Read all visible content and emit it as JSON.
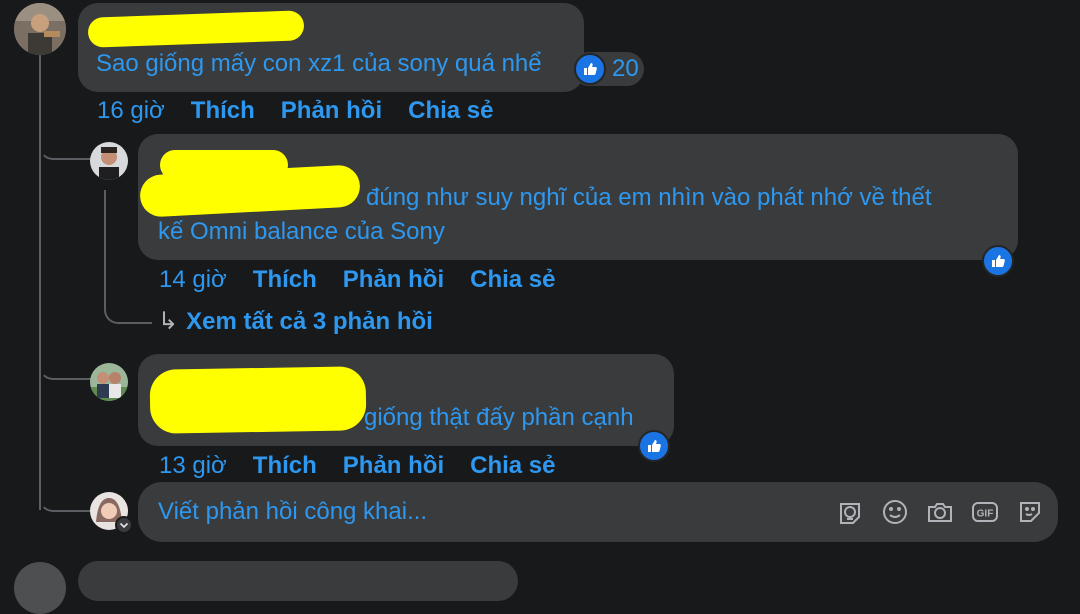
{
  "colors": {
    "background": "#18191a",
    "bubble": "#3a3b3c",
    "link": "#2e98f0",
    "like_blue": "#1b74e4",
    "redaction": "#ffff00"
  },
  "comment1": {
    "text": "Sao giống mấy con xz1 của sony quá nhể",
    "reaction_count": "20",
    "time": "16 giờ",
    "like": "Thích",
    "reply": "Phản hồi",
    "share": "Chia sẻ"
  },
  "reply1": {
    "text_line1": "đúng như suy nghĩ của em nhìn vào phát nhớ về thết",
    "text_line2": "kế Omni balance của Sony",
    "time": "14 giờ",
    "like": "Thích",
    "reply": "Phản hồi",
    "share": "Chia sẻ",
    "view_replies_arrow": "↳",
    "view_replies": "Xem tất cả 3 phản hồi"
  },
  "reply2": {
    "text": "giống thật đấy phần cạnh",
    "time": "13 giờ",
    "like": "Thích",
    "reply": "Phản hồi",
    "share": "Chia sẻ"
  },
  "composer": {
    "placeholder": "Viết phản hồi công khai...",
    "icons": [
      "avatar-sticker-icon",
      "emoji-icon",
      "camera-icon",
      "gif-icon",
      "sticker-icon"
    ]
  }
}
